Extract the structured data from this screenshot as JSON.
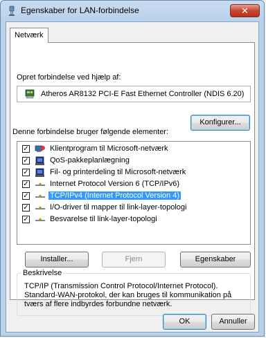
{
  "window": {
    "title": "Egenskaber for LAN-forbindelse",
    "close_label": "✕"
  },
  "tabs": [
    {
      "label": "Netværk"
    }
  ],
  "connect_using": {
    "label": "Opret forbindelse ved hjælp af:",
    "adapter": "Atheros AR8132 PCI-E Fast Ethernet Controller (NDIS 6.20)",
    "configure_label": "Konfigurer..."
  },
  "items": {
    "label": "Denne forbindelse bruger følgende elementer:",
    "list": [
      {
        "label": "Klientprogram til Microsoft-netværk",
        "checked": true,
        "icon": "network-client-icon",
        "selected": false
      },
      {
        "label": "QoS-pakkeplanlægning",
        "checked": true,
        "icon": "network-service-icon",
        "selected": false
      },
      {
        "label": "Fil- og printerdeling til Microsoft-netværk",
        "checked": true,
        "icon": "network-service-icon",
        "selected": false
      },
      {
        "label": "Internet Protocol Version 6 (TCP/IPv6)",
        "checked": true,
        "icon": "protocol-icon",
        "selected": false
      },
      {
        "label": "TCP/IPv4 (Internet Protocol Version 4)",
        "checked": true,
        "icon": "protocol-icon",
        "selected": true
      },
      {
        "label": "I/O-driver til mapper til link-layer-topologi",
        "checked": true,
        "icon": "protocol-icon",
        "selected": false
      },
      {
        "label": "Besvarelse til link-layer-topologi",
        "checked": true,
        "icon": "protocol-icon",
        "selected": false
      }
    ]
  },
  "buttons": {
    "install": "Installer...",
    "remove": "Fjern",
    "properties": "Egenskaber",
    "ok": "OK",
    "cancel": "Annuller"
  },
  "description": {
    "label": "Beskrivelse",
    "text": "TCP/IP (Transmission Control Protocol/Internet Protocol). Standard-WAN-protokol, der kan bruges til kommunikation på tværs af flere indbyrdes forbundne netværk."
  },
  "colors": {
    "selection": "#3399ff",
    "close_button": "#c8462f",
    "title_gradient": "#b9d1ea"
  }
}
